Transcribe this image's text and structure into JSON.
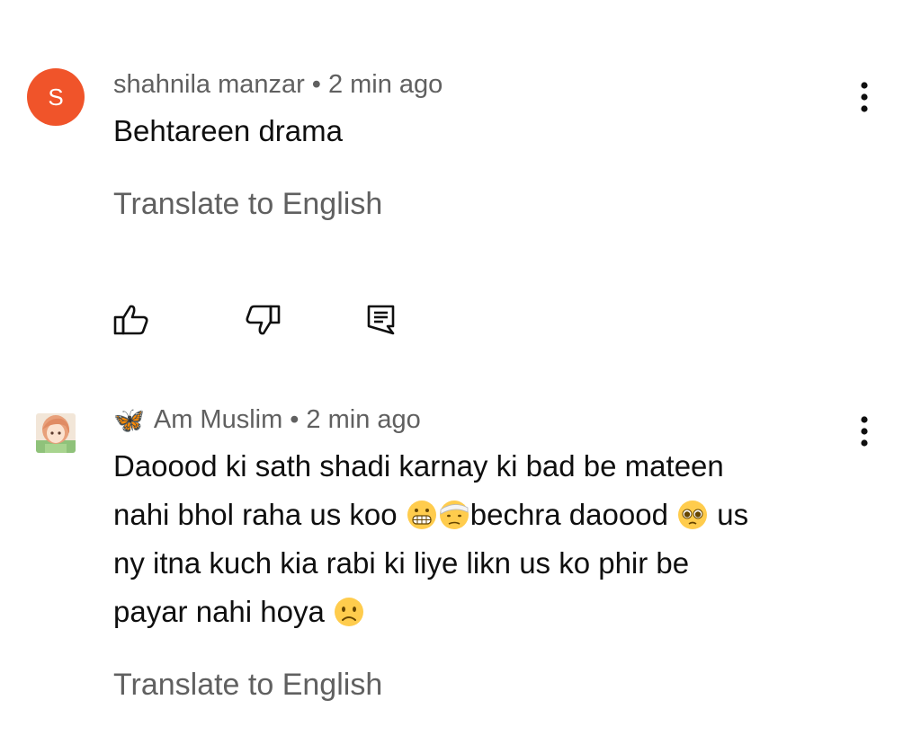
{
  "comments": [
    {
      "author": "shahnila manzar",
      "separator": "•",
      "time": "2 min ago",
      "avatar_letter": "S",
      "avatar_color": "#f0542a",
      "text_lines": [
        "Behtareen drama"
      ],
      "translate_label": "Translate to English",
      "actions": [
        "like-icon",
        "dislike-icon",
        "reply-icon"
      ],
      "menu_icon": "more-vert-icon"
    },
    {
      "author_emoji": "🦋",
      "author": "Am Muslim",
      "separator": "•",
      "time": "2 min ago",
      "text_lines": [
        "Daoood ki sath shadi karnay ki bad be mateen",
        "nahi bhol raha us koo ",
        "bechra daoood ",
        "  us",
        "ny itna kuch kia rabi ki liye likn  us  ko phir be",
        "payar nahi hoya "
      ],
      "emojis": [
        "grimacing-face-emoji",
        "head-bandage-face-emoji",
        "pleading-face-emoji",
        "frowning-face-emoji"
      ],
      "translate_label": "Translate to English",
      "menu_icon": "more-vert-icon"
    }
  ],
  "colors": {
    "primary_text": "#0f0f0f",
    "secondary_text": "#606060",
    "avatar_bg": "#f0542a"
  }
}
